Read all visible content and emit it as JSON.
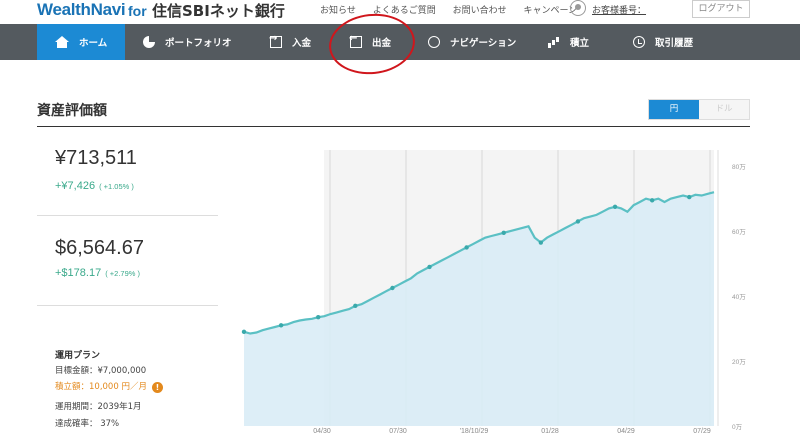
{
  "header": {
    "logo": "WealthNavi",
    "logo_for": "for",
    "logo_bank": "住信SBIネット銀行",
    "links": [
      "お知らせ",
      "よくあるご質問",
      "お問い合わせ",
      "キャンペーン"
    ],
    "customer_no": "お客様番号：",
    "logout": "ログアウト"
  },
  "nav": {
    "items": [
      {
        "label": "ホーム",
        "icon": "home-icon",
        "active": true
      },
      {
        "label": "ポートフォリオ",
        "icon": "pie-chart-icon"
      },
      {
        "label": "入金",
        "icon": "deposit-icon"
      },
      {
        "label": "出金",
        "icon": "withdraw-icon"
      },
      {
        "label": "ナビゲーション",
        "icon": "compass-icon"
      },
      {
        "label": "積立",
        "icon": "bar-chart-icon"
      },
      {
        "label": "取引履歴",
        "icon": "history-icon"
      }
    ]
  },
  "section": {
    "title": "資産評価額",
    "currency_toggle": {
      "yen": "円",
      "dollar": "ドル",
      "selected": "円"
    }
  },
  "summary": {
    "yen_amount": "¥713,511",
    "yen_diff": "+¥7,426",
    "yen_diff_pct": "( +1.05% )",
    "usd_amount": "$6,564.67",
    "usd_diff": "+$178.17",
    "usd_diff_pct": "( +2.79% )"
  },
  "plan": {
    "title": "運用プラン",
    "target": "目標金額：¥7,000,000",
    "monthly": "積立額：10,000 円／月",
    "period": "運用期間：2039年1月",
    "probability": "達成確率： 37%"
  },
  "colors": {
    "accent": "#1c8ad4",
    "navbar": "#545a5f",
    "positive": "#3aa98b",
    "warning": "#e3891d",
    "annotation": "#d0161c"
  },
  "chart_data": {
    "type": "area",
    "x_ticks": [
      "04/30",
      "07/30",
      "'18/10/29",
      "01/28",
      "04/29",
      "07/29"
    ],
    "y_ticks": [
      "0万",
      "20万",
      "40万",
      "60万",
      "80万"
    ],
    "ylim": [
      0,
      85
    ],
    "series": [
      {
        "values": [
          29,
          28.5,
          28.8,
          29.5,
          30,
          30.5,
          31,
          31.3,
          32,
          32.5,
          32.8,
          33,
          33.5,
          33.8,
          34.5,
          35,
          35.5,
          36,
          37,
          37.5,
          38.5,
          39.5,
          40.5,
          41.5,
          42.5,
          43.5,
          44.5,
          45.5,
          47,
          48,
          49,
          50,
          51,
          52,
          53,
          54,
          55,
          56,
          57,
          58,
          58.5,
          59,
          59.5,
          60,
          60.5,
          61,
          61.5,
          58,
          56.5,
          58,
          59,
          60,
          61,
          62,
          63,
          64,
          64.5,
          65,
          66,
          67,
          67.5,
          67,
          66,
          68,
          69,
          70,
          69.5,
          70,
          69,
          70,
          70.5,
          71,
          70.5,
          71.2,
          71,
          71.5,
          72
        ]
      }
    ]
  }
}
